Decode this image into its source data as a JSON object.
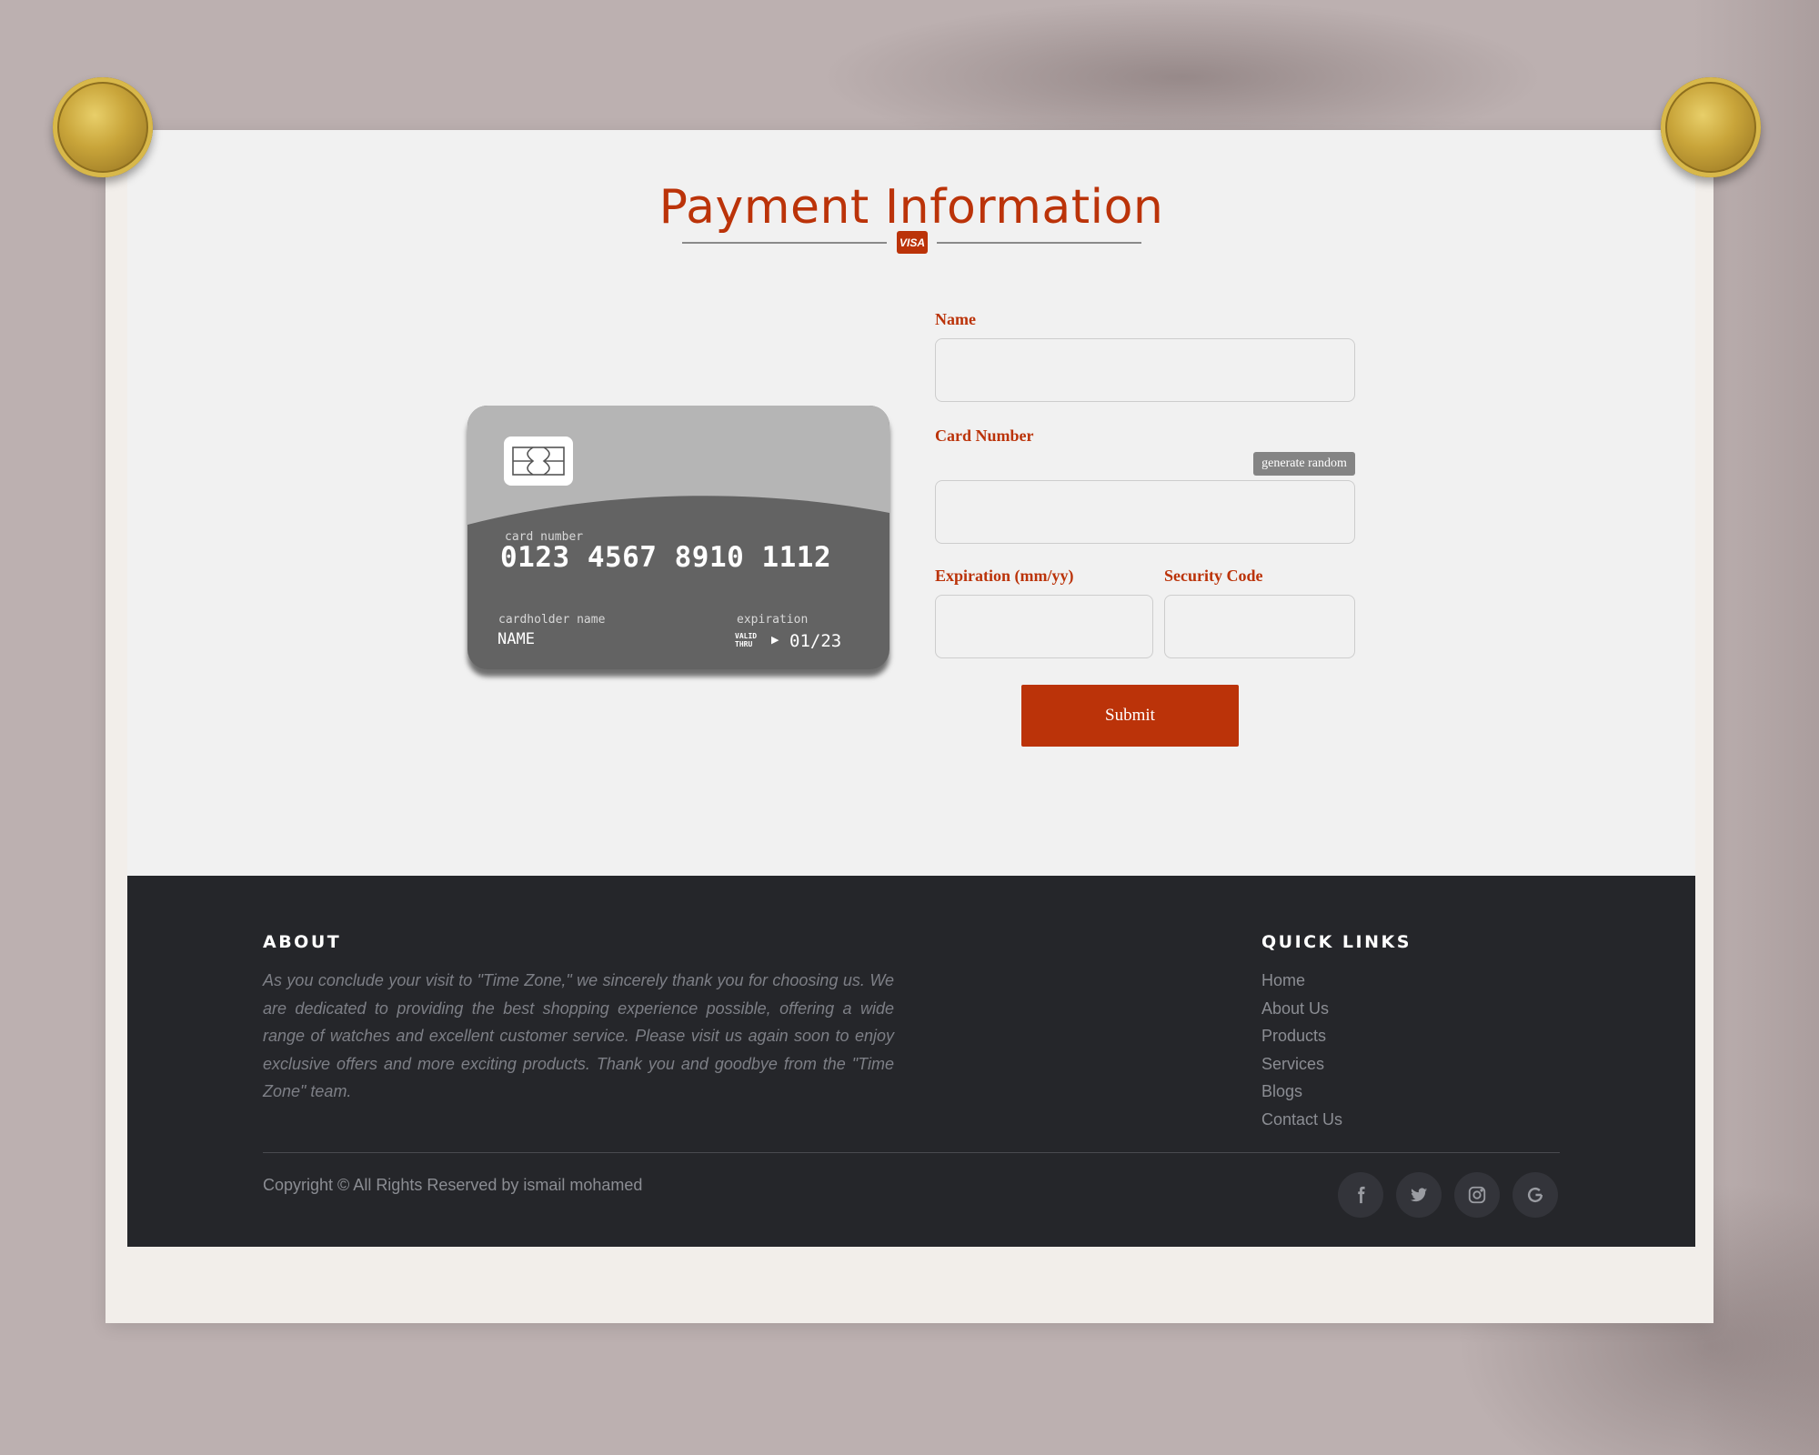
{
  "header": {
    "title": "Payment Information",
    "badge": "VISA"
  },
  "card": {
    "number_label": "card number",
    "number": "0123 4567 8910 1112",
    "holder_label": "cardholder name",
    "holder": "NAME",
    "expiration_label": "expiration",
    "valid_thru_line1": "VALID",
    "valid_thru_line2": "THRU",
    "valid_arrow": "▶",
    "expiration": "01/23"
  },
  "form": {
    "name_label": "Name",
    "name_value": "",
    "card_number_label": "Card Number",
    "card_number_value": "",
    "generate_label": "generate random",
    "expiration_label": "Expiration (mm/yy)",
    "expiration_value": "",
    "security_label": "Security Code",
    "security_value": "",
    "submit_label": "Submit"
  },
  "footer": {
    "about_heading": "ABOUT",
    "about_text": "As you conclude your visit to \"Time Zone,\" we sincerely thank you for choosing us. We are dedicated to providing the best shopping experience possible, offering a wide range of watches and excellent customer service. Please visit us again soon to enjoy exclusive offers and more exciting products. Thank you and goodbye from the \"Time Zone\" team.",
    "links_heading": "QUICK LINKS",
    "links": [
      "Home",
      "About Us",
      "Products",
      "Services",
      "Blogs",
      "Contact Us"
    ],
    "copyright": "Copyright © All Rights Reserved by ismail mohamed",
    "social": [
      "facebook-icon",
      "twitter-icon",
      "instagram-icon",
      "google-icon"
    ]
  },
  "colors": {
    "accent": "#bb3309",
    "footer_bg": "#25262a",
    "card_dark": "#636363",
    "card_light": "#b5b5b5",
    "backdrop": "#bcb0b0",
    "pin_gold": "#c9a53a"
  }
}
